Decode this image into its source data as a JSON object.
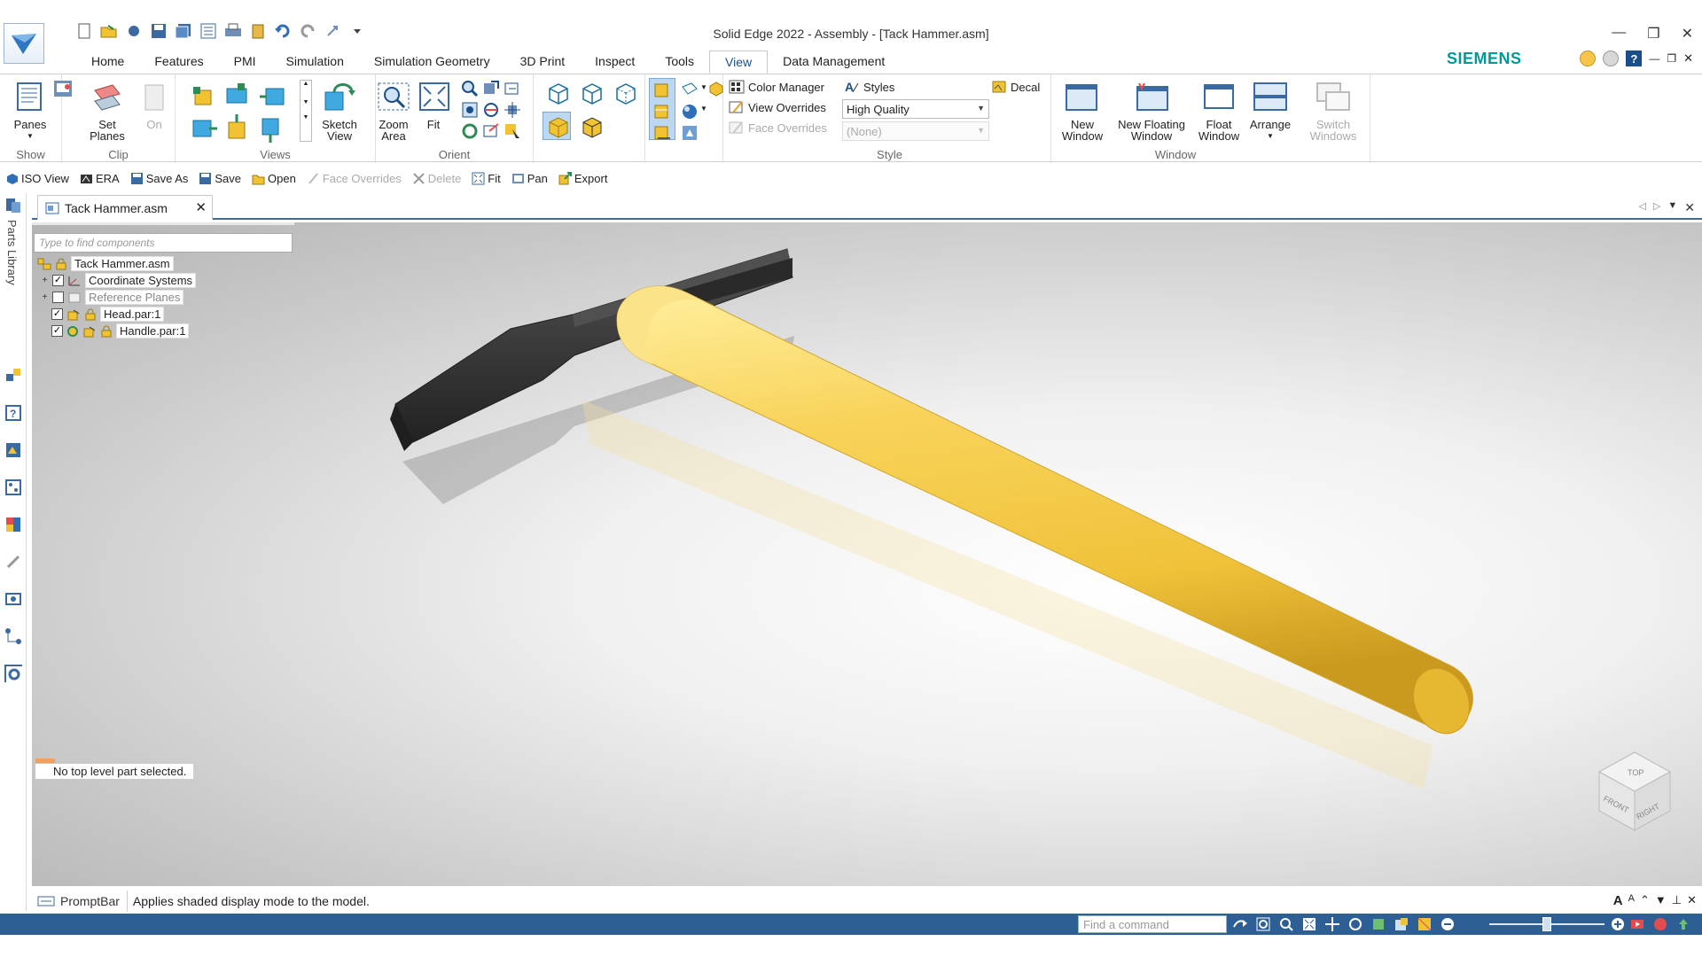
{
  "window": {
    "title": "Solid Edge 2022 - Assembly - [Tack Hammer.asm]",
    "brand": "SIEMENS",
    "brand_color": "#009999"
  },
  "ribbon_tabs": [
    {
      "label": "Home",
      "active": false
    },
    {
      "label": "Features",
      "active": false
    },
    {
      "label": "PMI",
      "active": false
    },
    {
      "label": "Simulation",
      "active": false
    },
    {
      "label": "Simulation Geometry",
      "active": false
    },
    {
      "label": "3D Print",
      "active": false
    },
    {
      "label": "Inspect",
      "active": false
    },
    {
      "label": "Tools",
      "active": false
    },
    {
      "label": "View",
      "active": true
    },
    {
      "label": "Data Management",
      "active": false
    }
  ],
  "ribbon": {
    "show": {
      "label": "Show",
      "panes": "Panes"
    },
    "clip": {
      "label": "Clip",
      "set_planes": "Set\nPlanes",
      "on": "On"
    },
    "views": {
      "label": "Views",
      "sketch_view": "Sketch\nView"
    },
    "orient": {
      "label": "Orient",
      "zoom_area": "Zoom\nArea",
      "fit": "Fit"
    },
    "style": {
      "label": "Style",
      "color_manager": "Color Manager",
      "styles": "Styles",
      "decal": "Decal",
      "view_overrides": "View Overrides",
      "view_overrides_value": "High Quality",
      "face_overrides": "Face Overrides",
      "face_overrides_value": "(None)"
    },
    "window": {
      "label": "Window",
      "new_window": "New\nWindow",
      "new_floating_window": "New Floating\nWindow",
      "float_window": "Float\nWindow",
      "arrange": "Arrange",
      "switch_windows": "Switch\nWindows"
    }
  },
  "command_bar": [
    {
      "label": "ISO View",
      "enabled": true
    },
    {
      "label": "ERA",
      "enabled": true
    },
    {
      "label": "Save As",
      "enabled": true
    },
    {
      "label": "Save",
      "enabled": true
    },
    {
      "label": "Open",
      "enabled": true
    },
    {
      "label": "Face Overrides",
      "enabled": false
    },
    {
      "label": "Delete",
      "enabled": false
    },
    {
      "label": "Fit",
      "enabled": true
    },
    {
      "label": "Pan",
      "enabled": true
    },
    {
      "label": "Export",
      "enabled": true
    }
  ],
  "document_tab": {
    "label": "Tack Hammer.asm"
  },
  "left_bar": {
    "parts_library": "Parts Library"
  },
  "tree": {
    "search_placeholder": "Type to find components",
    "root": "Tack Hammer.asm",
    "items": [
      {
        "label": "Coordinate Systems",
        "checked": true,
        "expandable": true
      },
      {
        "label": "Reference Planes",
        "checked": false,
        "expandable": true
      },
      {
        "label": "Head.par:1",
        "checked": true,
        "expandable": false
      },
      {
        "label": "Handle.par:1",
        "checked": true,
        "expandable": false
      }
    ]
  },
  "viewport": {
    "status_message": "No top level part selected.",
    "view_cube": {
      "front": "FRONT",
      "right": "RIGHT",
      "top": "TOP"
    }
  },
  "prompt_bar": {
    "label": "PromptBar",
    "text": "Applies shaded display mode to the model."
  },
  "status_bar": {
    "find_command_placeholder": "Find a command"
  },
  "colors": {
    "handle": "#f6cf55",
    "head": "#3a3a3a",
    "statusbar": "#2e5f94",
    "active_tab": "#1a4e8a"
  }
}
